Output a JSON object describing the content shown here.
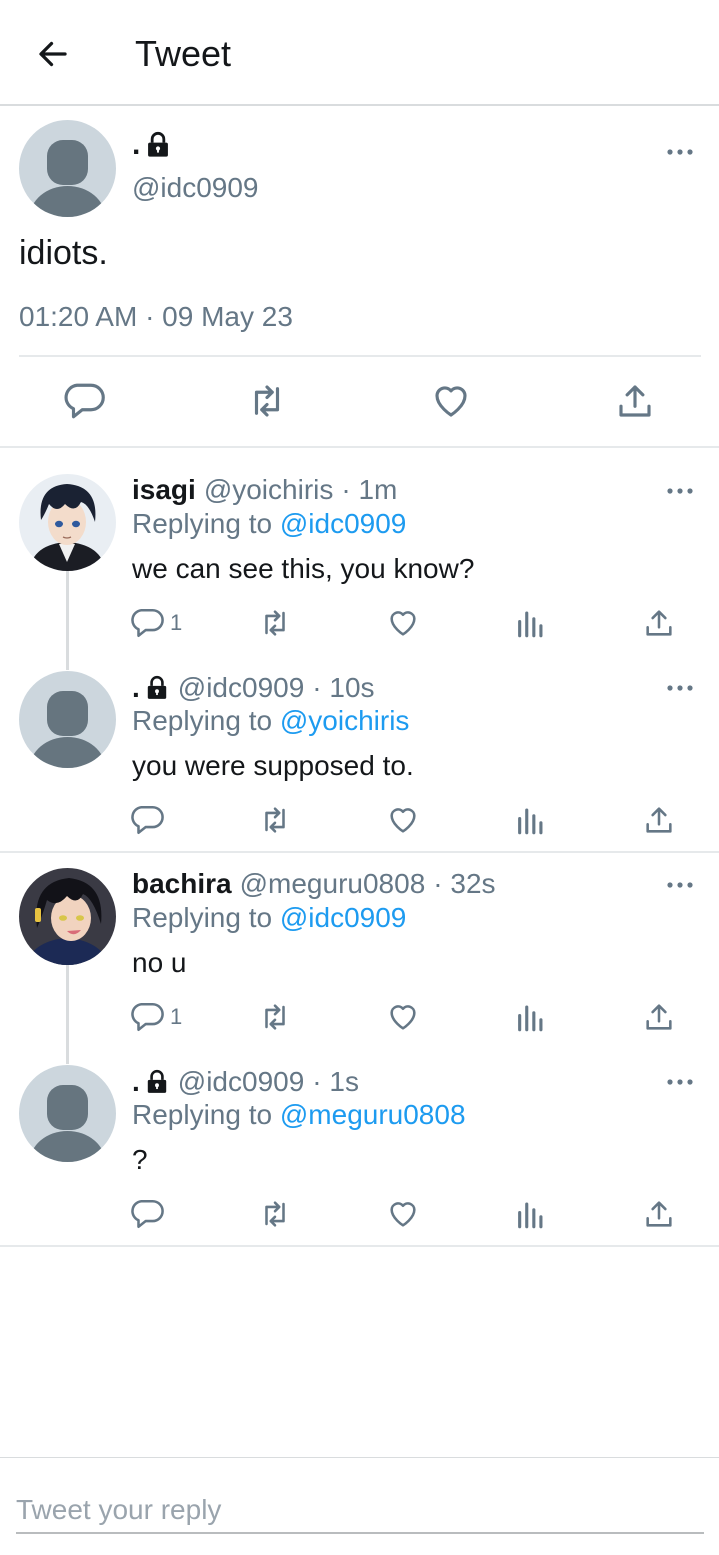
{
  "header": {
    "title": "Tweet"
  },
  "main_tweet": {
    "name": ".",
    "handle": "@idc0909",
    "text": "idiots.",
    "timestamp": "01:20 AM · 09 May 23"
  },
  "replies": [
    {
      "name": "isagi",
      "handle": "@yoichiris",
      "time": "· 1m",
      "replying_prefix": "Replying to ",
      "replying_to": "@idc0909",
      "text": "we can see this, you know?",
      "reply_count": "1"
    },
    {
      "name": ".",
      "handle": "@idc0909",
      "time": "· 10s",
      "replying_prefix": "Replying to ",
      "replying_to": "@yoichiris",
      "text": "you were supposed to.",
      "reply_count": ""
    },
    {
      "name": "bachira",
      "handle": "@meguru0808",
      "time": "· 32s",
      "replying_prefix": "Replying to ",
      "replying_to": "@idc0909",
      "text": "no u",
      "reply_count": "1"
    },
    {
      "name": ".",
      "handle": "@idc0909",
      "time": "· 1s",
      "replying_prefix": "Replying to ",
      "replying_to": "@meguru0808",
      "text": "?",
      "reply_count": ""
    }
  ],
  "composer": {
    "placeholder": "Tweet your reply"
  },
  "colors": {
    "link": "#1d9bf0",
    "muted": "#657786",
    "text": "#14171a",
    "avatar_bg": "#ccd6dd",
    "avatar_fg": "#66757f"
  },
  "icons": [
    "back-arrow-icon",
    "lock-icon",
    "more-icon",
    "reply-icon",
    "retweet-icon",
    "like-icon",
    "share-icon",
    "analytics-icon"
  ]
}
